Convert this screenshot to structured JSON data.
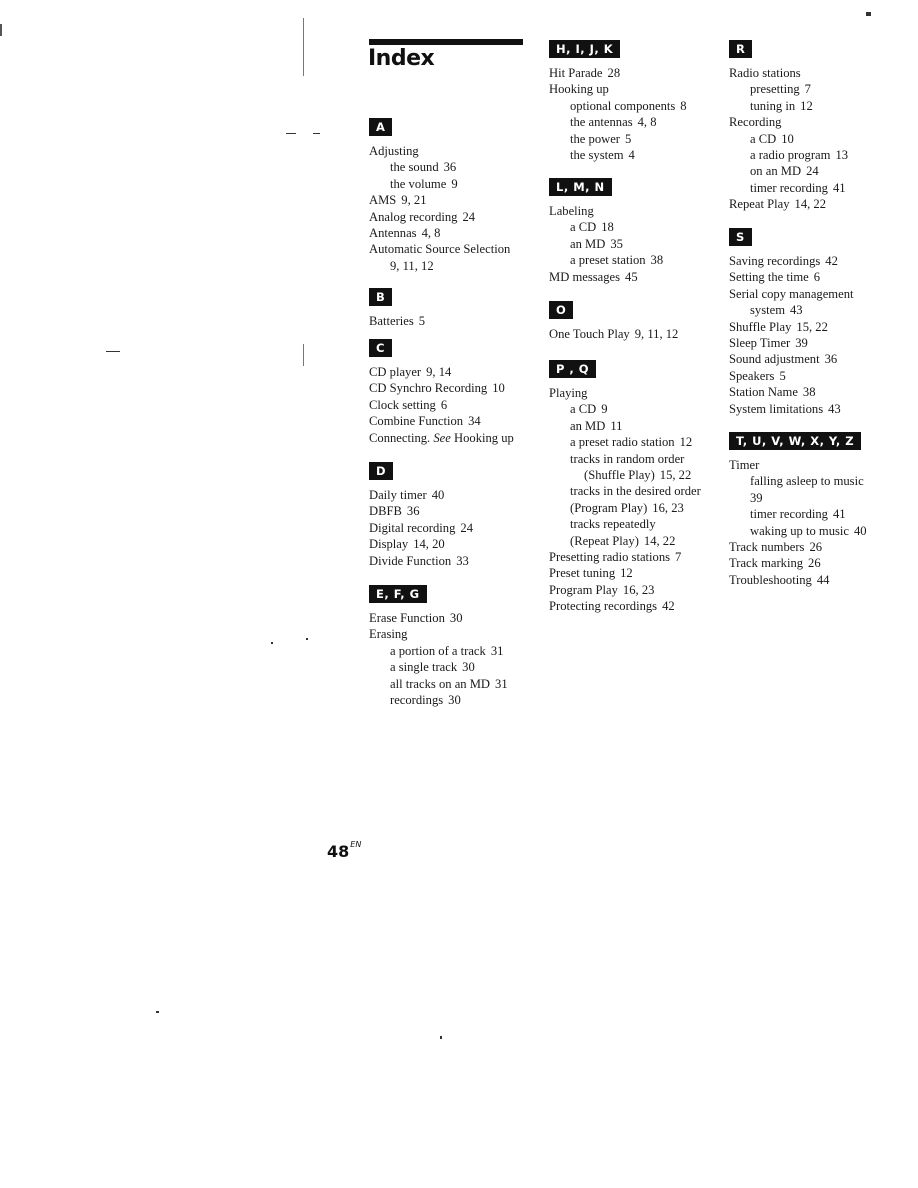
{
  "page": {
    "title": "Index",
    "page_number": "48",
    "page_suffix": "EN"
  },
  "sections": {
    "A": {
      "label": "A",
      "entries": [
        {
          "text": "Adjusting",
          "pages": ""
        },
        {
          "text": "the sound",
          "pages": "36"
        },
        {
          "text": "the volume",
          "pages": "9"
        },
        {
          "text": "AMS",
          "pages": "9, 21"
        },
        {
          "text": "Analog recording",
          "pages": "24"
        },
        {
          "text": "Antennas",
          "pages": "4, 8"
        },
        {
          "text": "Automatic Source Selection",
          "pages": "9, 11, 12"
        }
      ]
    },
    "B": {
      "label": "B",
      "entries": [
        {
          "text": "Batteries",
          "pages": "5"
        }
      ]
    },
    "C": {
      "label": "C",
      "entries": [
        {
          "text": "CD player",
          "pages": "9, 14"
        },
        {
          "text": "CD Synchro Recording",
          "pages": "10"
        },
        {
          "text": "Clock setting",
          "pages": "6"
        },
        {
          "text": "Combine Function",
          "pages": "34"
        },
        {
          "text": "Connecting.",
          "see": "See",
          "pages": "Hooking up"
        }
      ]
    },
    "D": {
      "label": "D",
      "entries": [
        {
          "text": "Daily timer",
          "pages": "40"
        },
        {
          "text": "DBFB",
          "pages": "36"
        },
        {
          "text": "Digital recording",
          "pages": "24"
        },
        {
          "text": "Display",
          "pages": "14, 20"
        },
        {
          "text": "Divide Function",
          "pages": "33"
        }
      ]
    },
    "EFG": {
      "label": "E, F, G",
      "entries": [
        {
          "text": "Erase Function",
          "pages": "30"
        },
        {
          "text": "Erasing",
          "pages": ""
        },
        {
          "text": "a portion of a track",
          "pages": "31"
        },
        {
          "text": "a single track",
          "pages": "30"
        },
        {
          "text": "all tracks on an MD",
          "pages": "31"
        },
        {
          "text": "recordings",
          "pages": "30"
        }
      ]
    },
    "HIJK": {
      "label": "H, I, J, K",
      "entries": [
        {
          "text": "Hit Parade",
          "pages": "28"
        },
        {
          "text": "Hooking up",
          "pages": ""
        },
        {
          "text": "optional components",
          "pages": "8"
        },
        {
          "text": "the antennas",
          "pages": "4, 8"
        },
        {
          "text": "the power",
          "pages": "5"
        },
        {
          "text": "the system",
          "pages": "4"
        }
      ]
    },
    "LMN": {
      "label": "L, M, N",
      "entries": [
        {
          "text": "Labeling",
          "pages": ""
        },
        {
          "text": "a CD",
          "pages": "18"
        },
        {
          "text": "an MD",
          "pages": "35"
        },
        {
          "text": "a preset station",
          "pages": "38"
        },
        {
          "text": "MD messages",
          "pages": "45"
        }
      ]
    },
    "O": {
      "label": "O",
      "entries": [
        {
          "text": "One Touch Play",
          "pages": "9, 11, 12"
        }
      ]
    },
    "PQ": {
      "label": "P , Q",
      "entries": [
        {
          "text": "Playing",
          "pages": ""
        },
        {
          "text": "a CD",
          "pages": "9"
        },
        {
          "text": "an MD",
          "pages": "11"
        },
        {
          "text": "a preset radio station",
          "pages": "12"
        },
        {
          "text": "tracks in random order",
          "cont": "(Shuffle Play)",
          "pages": "15, 22"
        },
        {
          "text": "tracks in the desired order (Program Play)",
          "pages": "16, 23"
        },
        {
          "text": "tracks repeatedly (Repeat Play)",
          "pages": "14, 22"
        },
        {
          "text": "Presetting radio stations",
          "pages": "7"
        },
        {
          "text": "Preset tuning",
          "pages": "12"
        },
        {
          "text": "Program Play",
          "pages": "16, 23"
        },
        {
          "text": "Protecting recordings",
          "pages": "42"
        }
      ]
    },
    "R": {
      "label": "R",
      "entries": [
        {
          "text": "Radio stations",
          "pages": ""
        },
        {
          "text": "presetting",
          "pages": "7"
        },
        {
          "text": "tuning in",
          "pages": "12"
        },
        {
          "text": "Recording",
          "pages": ""
        },
        {
          "text": "a CD",
          "pages": "10"
        },
        {
          "text": "a radio program",
          "pages": "13"
        },
        {
          "text": "on an MD",
          "pages": "24"
        },
        {
          "text": "timer recording",
          "pages": "41"
        },
        {
          "text": "Repeat Play",
          "pages": "14, 22"
        }
      ]
    },
    "S": {
      "label": "S",
      "entries": [
        {
          "text": "Saving recordings",
          "pages": "42"
        },
        {
          "text": "Setting the time",
          "pages": "6"
        },
        {
          "text": "Serial copy management",
          "cont": "system",
          "pages": "43"
        },
        {
          "text": "Shuffle Play",
          "pages": "15, 22"
        },
        {
          "text": "Sleep Timer",
          "pages": "39"
        },
        {
          "text": "Sound adjustment",
          "pages": "36"
        },
        {
          "text": "Speakers",
          "pages": "5"
        },
        {
          "text": "Station Name",
          "pages": "38"
        },
        {
          "text": "System limitations",
          "pages": "43"
        }
      ]
    },
    "TZ": {
      "label": "T, U, V, W, X, Y, Z",
      "entries": [
        {
          "text": "Timer",
          "pages": ""
        },
        {
          "text": "falling asleep to music",
          "pages": "39"
        },
        {
          "text": "timer recording",
          "pages": "41"
        },
        {
          "text": "waking up to music",
          "pages": "40"
        },
        {
          "text": "Track numbers",
          "pages": "26"
        },
        {
          "text": "Track marking",
          "pages": "26"
        },
        {
          "text": "Troubleshooting",
          "pages": "44"
        }
      ]
    }
  }
}
